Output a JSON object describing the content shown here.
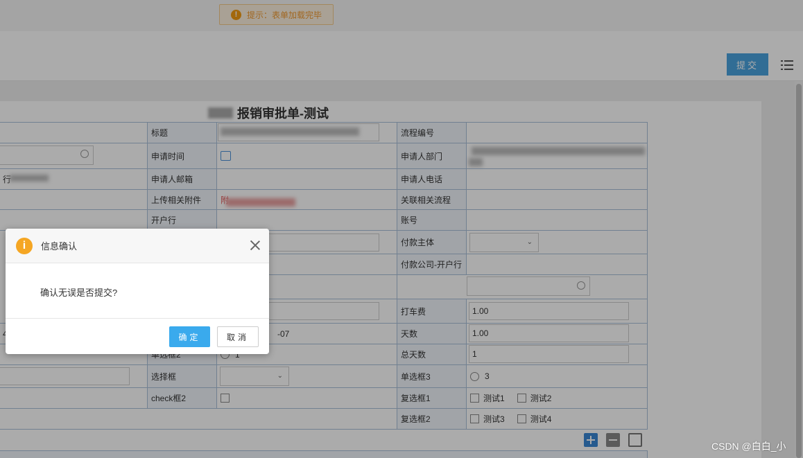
{
  "toast": {
    "text": "提示：表单加载完毕",
    "icon": "info-icon"
  },
  "toolbar": {
    "submit_label": "提交",
    "menu_icon": "list-icon"
  },
  "form": {
    "title": "报销审批单-测试",
    "fields": {
      "title_label": "标题",
      "process_no_label": "流程编号",
      "apply_time_label": "申请时间",
      "dept_label": "申请人部门",
      "email_label": "申请人邮箱",
      "phone_label": "申请人电话",
      "attachment_label": "上传相关附件",
      "related_process_label": "关联相关流程",
      "bank_label": "开户行",
      "account_label": "账号",
      "pay_subject_label": "付款主体",
      "pay_company_bank_label": "付款公司-开户行",
      "taxi_fee_label": "打车费",
      "taxi_fee_value": "1.00",
      "days_label": "天数",
      "days_value": "1.00",
      "radio2_label": "单选框2",
      "radio2_option": "1",
      "total_days_label": "总天数",
      "total_days_value": "1",
      "select_label": "选择框",
      "radio3_label": "单选框3",
      "radio3_option": "3",
      "check2_label": "check框2",
      "checkbox1_label": "复选框1",
      "checkbox1_opt1": "测试1",
      "checkbox1_opt2": "测试2",
      "checkbox2_label": "复选框2",
      "checkbox2_opt1": "测试3",
      "checkbox2_opt2": "测试4",
      "date_fragment": "-07",
      "left_fragment": "行",
      "left_fragment2": "4-",
      "attach_fragment": "附"
    }
  },
  "dialog": {
    "title": "信息确认",
    "message": "确认无误是否提交?",
    "ok_label": "确定",
    "cancel_label": "取消"
  },
  "watermark": "CSDN @白白_小",
  "colors": {
    "accent": "#3aaaed",
    "warning": "#f5a623",
    "submit": "#4aa3df"
  }
}
